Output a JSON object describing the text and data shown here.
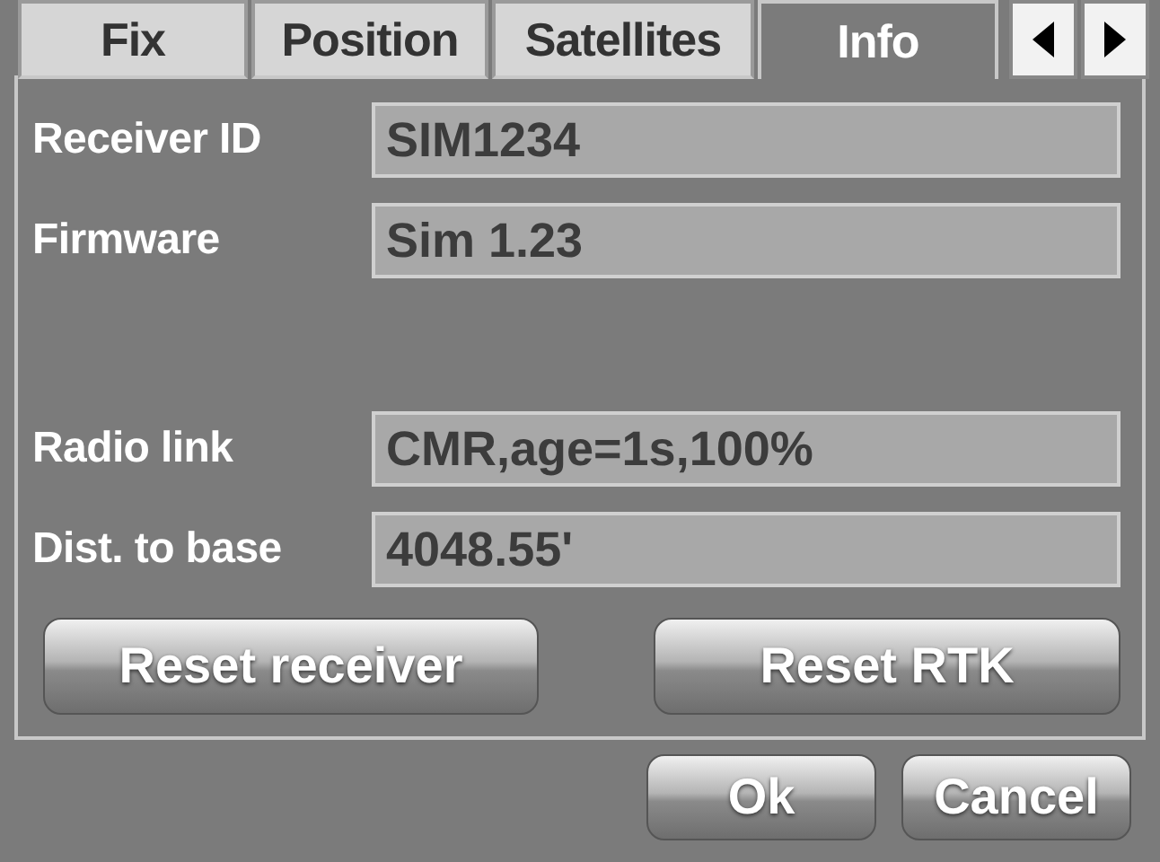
{
  "tabs": [
    {
      "label": "Fix",
      "selected": false
    },
    {
      "label": "Position",
      "selected": false
    },
    {
      "label": "Satellites",
      "selected": false
    },
    {
      "label": "Info",
      "selected": true
    }
  ],
  "fields": [
    {
      "label": "Receiver ID",
      "value": "SIM1234"
    },
    {
      "label": "Firmware",
      "value": "Sim 1.23"
    },
    {
      "label": "Radio link",
      "value": "CMR,age=1s,100%"
    },
    {
      "label": "Dist. to base",
      "value": "4048.55'"
    }
  ],
  "actions": [
    "Reset receiver",
    "Reset RTK"
  ],
  "buttons": [
    "Ok",
    "Cancel"
  ]
}
